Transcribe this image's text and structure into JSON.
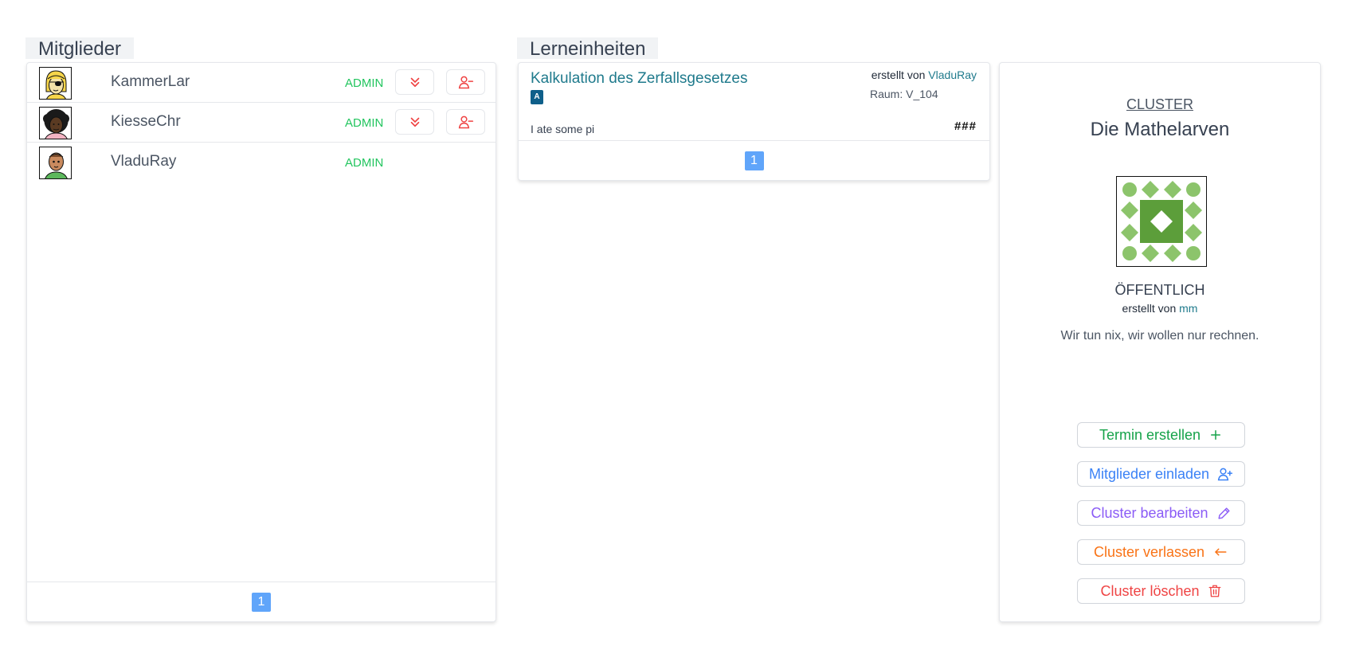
{
  "members": {
    "title": "Mitglieder",
    "rows": [
      {
        "name": "KammerLar",
        "role": "ADMIN",
        "has_actions": true
      },
      {
        "name": "KiesseChr",
        "role": "ADMIN",
        "has_actions": true
      },
      {
        "name": "VladuRay",
        "role": "ADMIN",
        "has_actions": false
      }
    ],
    "demote_icon": "chevrons-down-icon",
    "remove_icon": "user-minus-icon",
    "page": "1"
  },
  "lessons": {
    "title": "Lerneinheiten",
    "items": [
      {
        "title": "Kalkulation des Zerfallsgesetzes",
        "badge": "A",
        "created_by_label": "erstellt von",
        "creator": "VladuRay",
        "room": "Raum: V_104",
        "description": "I ate some pi",
        "tag": "###"
      }
    ],
    "page": "1"
  },
  "cluster": {
    "label": "CLUSTER",
    "name": "Die Mathelarven",
    "visibility": "ÖFFENTLICH",
    "created_by_label": "erstellt von",
    "creator": "mm",
    "description": "Wir tun nix, wir wollen nur rechnen.",
    "actions": [
      {
        "label": "Termin erstellen",
        "icon": "plus-icon",
        "color": "#16a34a"
      },
      {
        "label": "Mitglieder einladen",
        "icon": "user-plus-icon",
        "color": "#3b82f6"
      },
      {
        "label": "Cluster bearbeiten",
        "icon": "pencil-icon",
        "color": "#8b5cf6"
      },
      {
        "label": "Cluster verlassen",
        "icon": "arrow-left-icon",
        "color": "#f97316"
      },
      {
        "label": "Cluster löschen",
        "icon": "trash-icon",
        "color": "#ef4444"
      }
    ]
  },
  "colors": {
    "admin": "#22c55e",
    "danger": "#ef4444",
    "link": "#1f7a8c",
    "page_active": "#60a5fa"
  }
}
